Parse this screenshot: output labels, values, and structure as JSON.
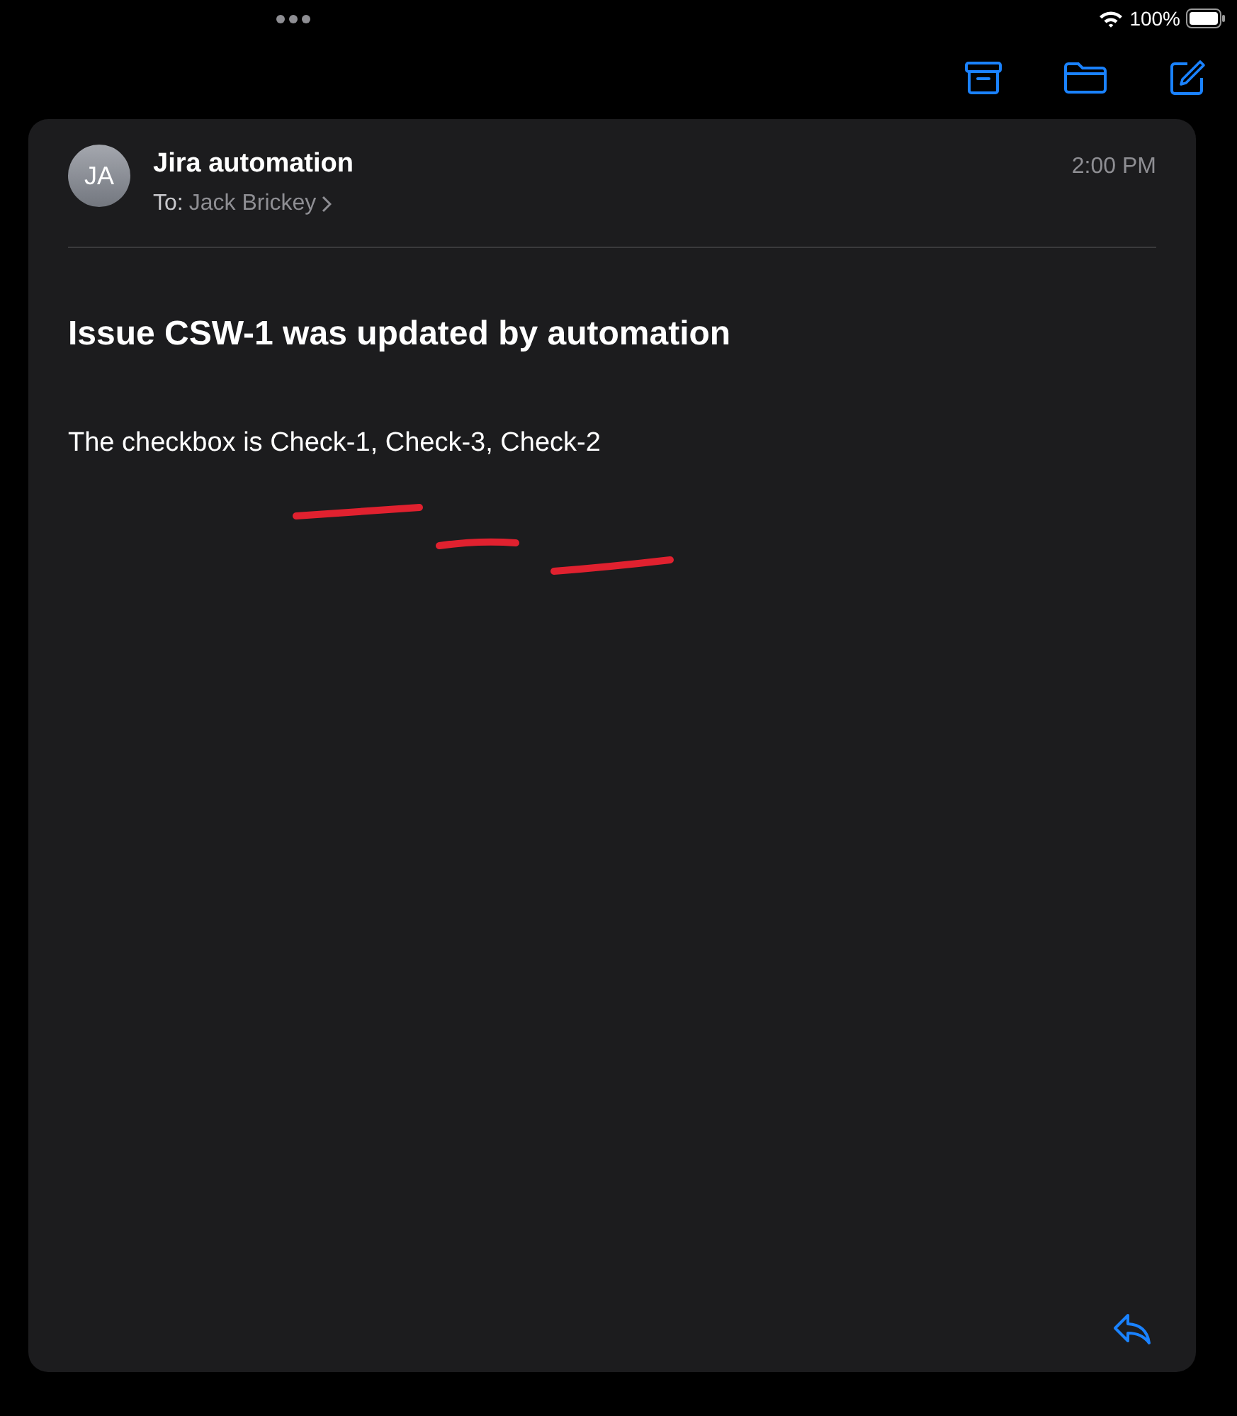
{
  "status_bar": {
    "battery": "100%"
  },
  "message": {
    "avatar_initials": "JA",
    "sender": "Jira automation",
    "to_label": "To:",
    "recipient": "Jack Brickey",
    "time": "2:00 PM",
    "subject": "Issue CSW-1 was updated by automation",
    "body": "The checkbox is Check-1, Check-3, Check-2"
  }
}
